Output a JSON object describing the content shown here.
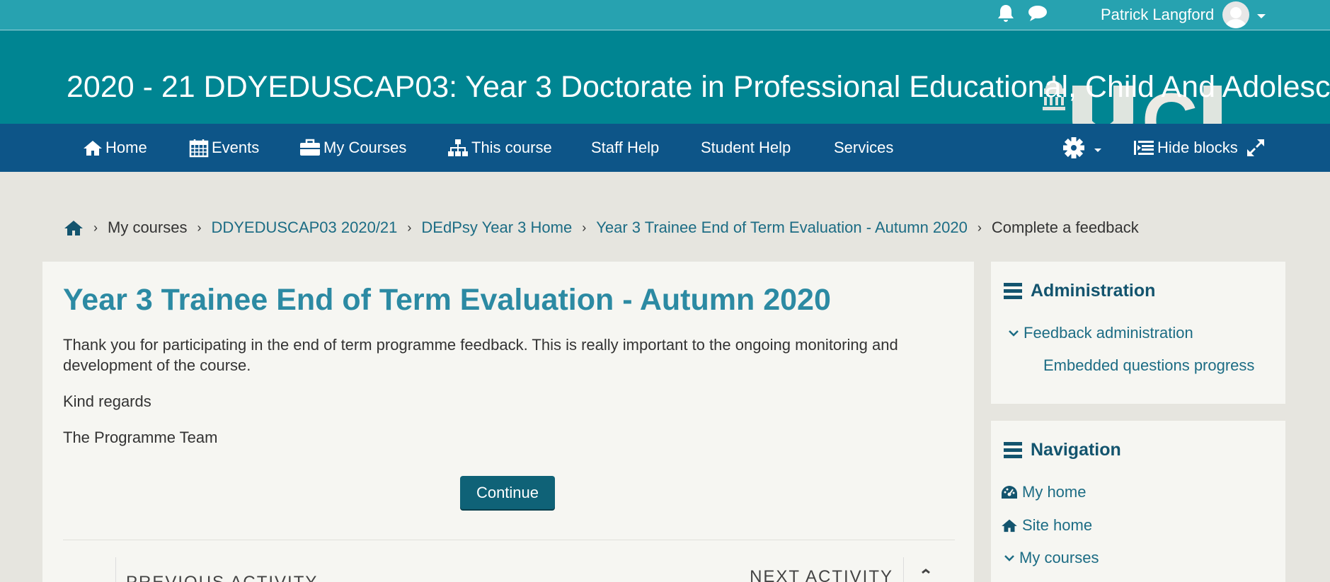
{
  "topbar": {
    "user_name": "Patrick Langford",
    "icons": [
      "bell-icon",
      "chat-icon",
      "avatar",
      "caret-down-icon"
    ]
  },
  "banner": {
    "course_title": "2020 - 21 DDYEDUSCAP03: Year 3 Doctorate in Professional Educational, Child And Adolescent",
    "logo_text": "UCL"
  },
  "nav": {
    "items": [
      {
        "label": "Home",
        "icon": "home-icon"
      },
      {
        "label": "Events",
        "icon": "calendar-icon"
      },
      {
        "label": "My Courses",
        "icon": "briefcase-icon"
      },
      {
        "label": "This course",
        "icon": "sitemap-icon"
      },
      {
        "label": "Staff Help"
      },
      {
        "label": "Student Help"
      },
      {
        "label": "Services"
      }
    ],
    "hide_blocks": "Hide blocks"
  },
  "breadcrumb": {
    "items": [
      "My courses",
      "DDYEDUSCAP03 2020/21",
      "DEdPsy Year 3 Home",
      "Year 3 Trainee End of Term Evaluation - Autumn 2020",
      "Complete a feedback"
    ]
  },
  "main": {
    "title": "Year 3 Trainee End of Term Evaluation - Autumn 2020",
    "paragraphs": [
      "Thank you for participating in the end of term programme feedback.  This is really important to the ongoing monitoring and development of the course.",
      "Kind regards",
      "The Programme Team"
    ],
    "continue_label": "Continue",
    "previous_label": "PREVIOUS ACTIVITY",
    "next_label": "NEXT ACTIVITY"
  },
  "administration": {
    "title": "Administration",
    "items": [
      "Feedback administration",
      "Embedded questions progress"
    ]
  },
  "navigation": {
    "title": "Navigation",
    "items": [
      "My home",
      "Site home",
      "My courses"
    ]
  },
  "colors": {
    "topbar": "#27a2b0",
    "banner": "#008592",
    "navbar": "#0d5588",
    "button": "#0f6277",
    "title": "#2c8aa3"
  }
}
